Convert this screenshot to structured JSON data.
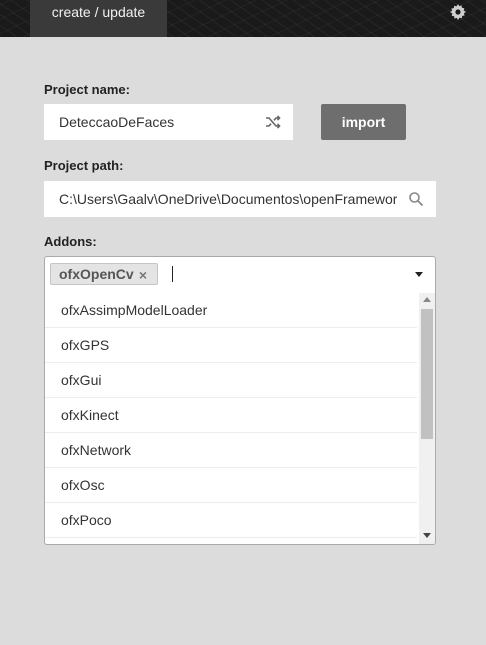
{
  "header": {
    "tab_label": "create / update",
    "settings_icon": "gear-icon"
  },
  "project_name": {
    "label": "Project name:",
    "value": "DeteccaoDeFaces",
    "icon": "shuffle-icon"
  },
  "import_button": {
    "label": "import"
  },
  "project_path": {
    "label": "Project path:",
    "value": "C:\\Users\\Gaalv\\OneDrive\\Documentos\\openFramewor",
    "icon": "search-icon"
  },
  "addons": {
    "label": "Addons:",
    "selected": [
      {
        "name": "ofxOpenCv",
        "remove": "×"
      }
    ],
    "options": [
      "ofxAssimpModelLoader",
      "ofxGPS",
      "ofxGui",
      "ofxKinect",
      "ofxNetwork",
      "ofxOsc",
      "ofxPoco"
    ]
  }
}
